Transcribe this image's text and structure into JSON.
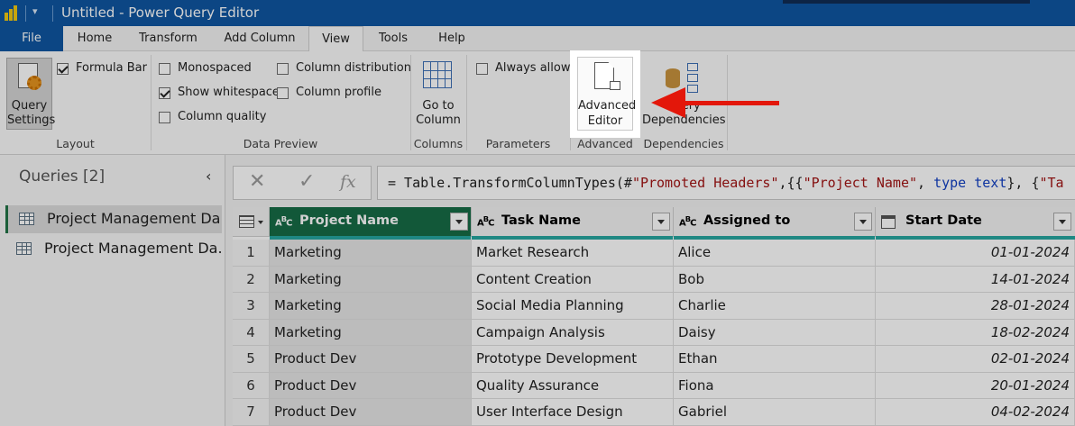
{
  "titlebar": {
    "title": "Untitled - Power Query Editor",
    "qa_symbol": "▾"
  },
  "tabs": [
    {
      "label": "File"
    },
    {
      "label": "Home"
    },
    {
      "label": "Transform"
    },
    {
      "label": "Add Column"
    },
    {
      "label": "View"
    },
    {
      "label": "Tools"
    },
    {
      "label": "Help"
    }
  ],
  "ribbon": {
    "layout": {
      "query_settings_line1": "Query",
      "query_settings_line2": "Settings",
      "formula_bar": "Formula Bar",
      "formula_bar_checked": true,
      "group": "Layout"
    },
    "data_preview": {
      "monospaced": "Monospaced",
      "show_whitespace": "Show whitespace",
      "show_whitespace_checked": true,
      "column_quality": "Column quality",
      "column_distribution": "Column distribution",
      "column_profile": "Column profile",
      "group": "Data Preview"
    },
    "columns": {
      "line1": "Go to",
      "line2": "Column",
      "group": "Columns"
    },
    "parameters": {
      "always_allow": "Always allow",
      "group": "Parameters"
    },
    "advanced": {
      "line1": "Advanced",
      "line2": "Editor",
      "group": "Advanced"
    },
    "dependencies": {
      "line1": "Query",
      "line2": "Dependencies",
      "group": "Dependencies"
    }
  },
  "queries": {
    "title": "Queries [2]",
    "collapse_symbol": "‹",
    "items": [
      "Project Management Da...",
      "Project Management Da..."
    ]
  },
  "formula": {
    "cancel": "✕",
    "confirm": "✓",
    "fx": "fx",
    "prefix": "= Table.TransformColumnTypes(#",
    "s1": "\"Promoted Headers\"",
    "mid1": ",{{",
    "s2": "\"Project Name\"",
    "mid2": ", ",
    "kw1": "type",
    "kw2": "text",
    "mid3": "}, {",
    "s3": "\"Ta"
  },
  "grid": {
    "columns": [
      "Project Name",
      "Task Name",
      "Assigned to",
      "Start Date"
    ],
    "abc": "ABC",
    "rows": [
      [
        "1",
        "Marketing",
        "Market Research",
        "Alice",
        "01-01-2024"
      ],
      [
        "2",
        "Marketing",
        "Content Creation",
        "Bob",
        "14-01-2024"
      ],
      [
        "3",
        "Marketing",
        "Social Media Planning",
        "Charlie",
        "28-01-2024"
      ],
      [
        "4",
        "Marketing",
        "Campaign Analysis",
        "Daisy",
        "18-02-2024"
      ],
      [
        "5",
        "Product Dev",
        "Prototype Development",
        "Ethan",
        "02-01-2024"
      ],
      [
        "6",
        "Product Dev",
        "Quality Assurance",
        "Fiona",
        "20-01-2024"
      ],
      [
        "7",
        "Product Dev",
        "User Interface Design",
        "Gabriel",
        "04-02-2024"
      ]
    ]
  },
  "colors": {
    "accent": "#0f56a1",
    "selected_column": "#166c46",
    "quality_bar": "#27a6a0",
    "arrow": "#e3170a"
  }
}
